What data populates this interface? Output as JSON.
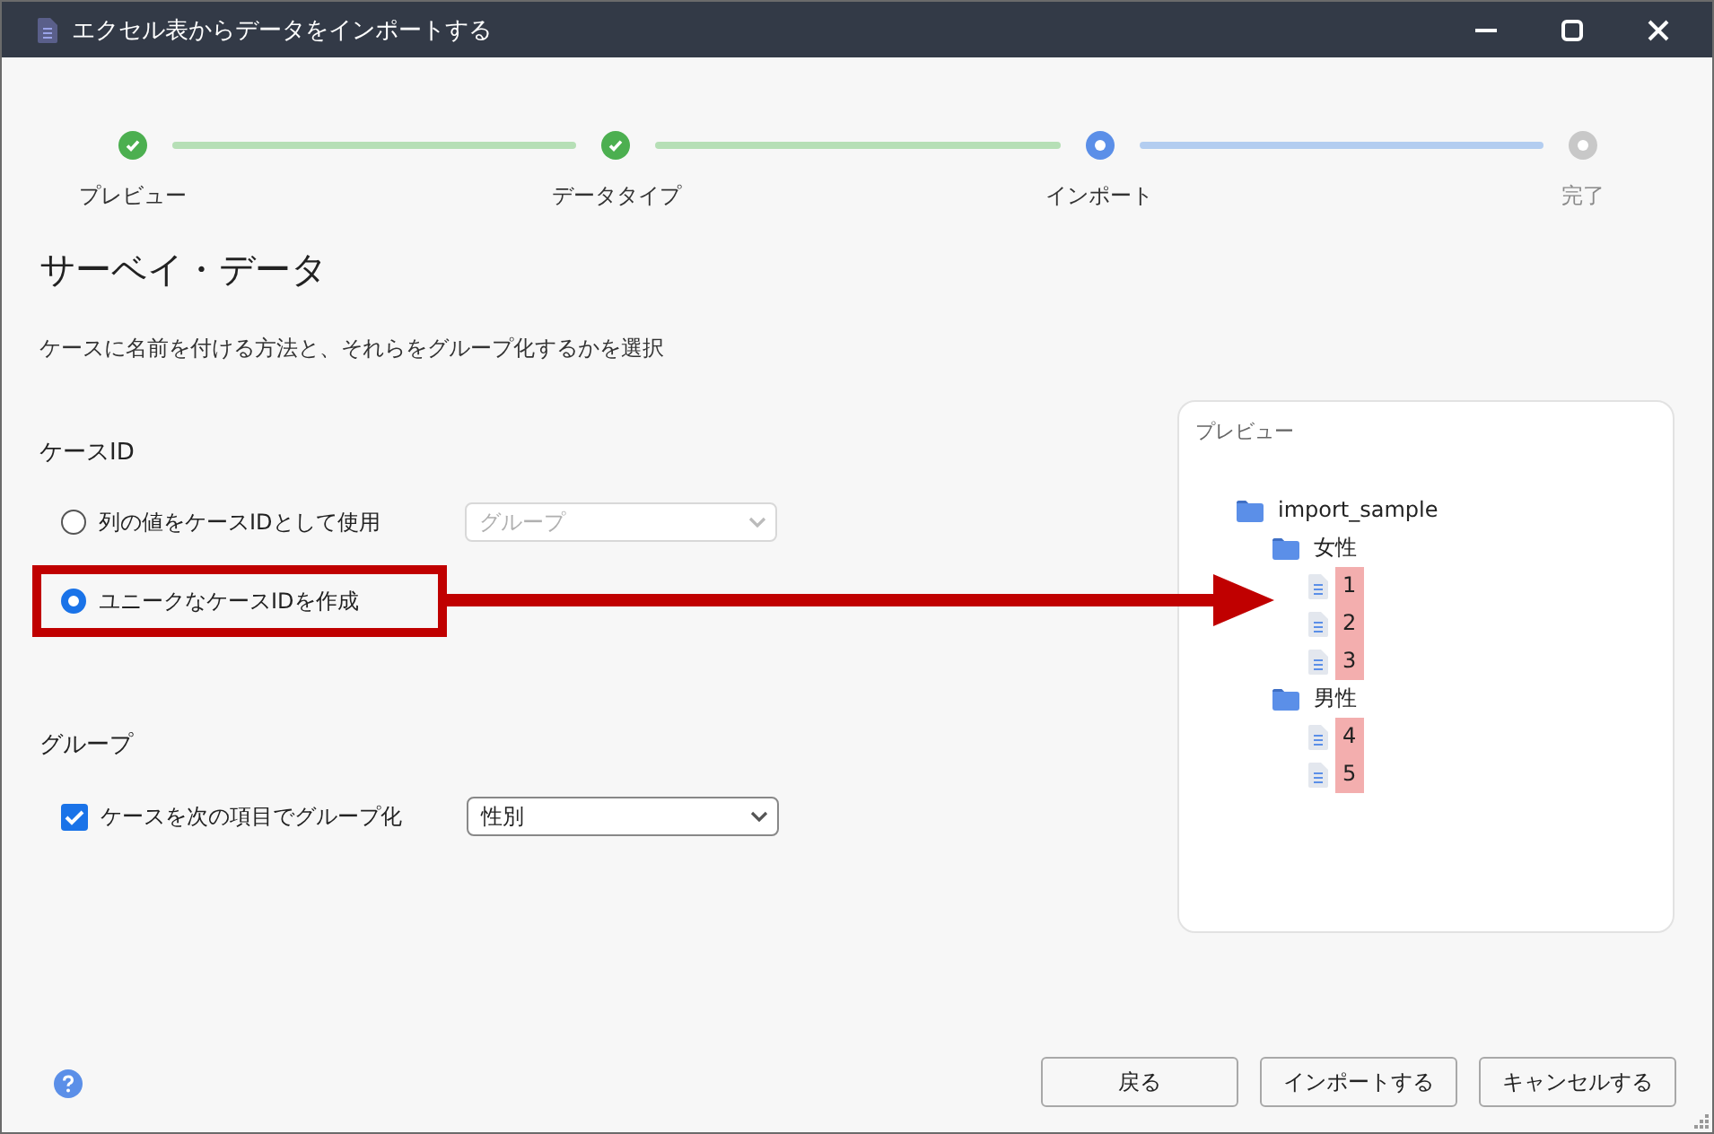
{
  "window": {
    "title": "エクセル表からデータをインポートする"
  },
  "steps": [
    {
      "label": "プレビュー",
      "completed": true,
      "selected": false
    },
    {
      "label": "データタイプ",
      "completed": true,
      "selected": false
    },
    {
      "label": "インポート",
      "completed": false,
      "selected": true
    },
    {
      "label": "完了",
      "completed": false,
      "selected": false
    }
  ],
  "heading": "サーベイ・データ",
  "description": "ケースに名前を付ける方法と、それらをグループ化するかを選択",
  "case_id": {
    "label": "ケースID",
    "options": [
      {
        "label": "列の値をケースIDとして使用",
        "selected": false,
        "annotated": false,
        "dropdown": {
          "placeholder": "グループ",
          "disabled": true
        }
      },
      {
        "label": "ユニークなケースIDを作成",
        "selected": true,
        "annotated": true
      }
    ]
  },
  "group": {
    "label": "グループ",
    "checkbox": {
      "label": "ケースを次の項目でグループ化",
      "checked": true
    },
    "dropdown": {
      "value": "性別",
      "disabled": false
    }
  },
  "preview": {
    "title": "プレビュー",
    "tree": [
      {
        "label": "import_sample",
        "kind": "folder",
        "children": [
          {
            "label": "女性",
            "kind": "folder",
            "children": [
              {
                "label": "1",
                "kind": "file",
                "highlighted": true
              },
              {
                "label": "2",
                "kind": "file",
                "highlighted": true
              },
              {
                "label": "3",
                "kind": "file",
                "highlighted": true
              }
            ]
          },
          {
            "label": "男性",
            "kind": "folder",
            "children": [
              {
                "label": "4",
                "kind": "file",
                "highlighted": true
              },
              {
                "label": "5",
                "kind": "file",
                "highlighted": true
              }
            ]
          }
        ]
      }
    ]
  },
  "buttons": [
    {
      "label": "戻る"
    },
    {
      "label": "インポートする"
    },
    {
      "label": "キャンセルする"
    }
  ]
}
